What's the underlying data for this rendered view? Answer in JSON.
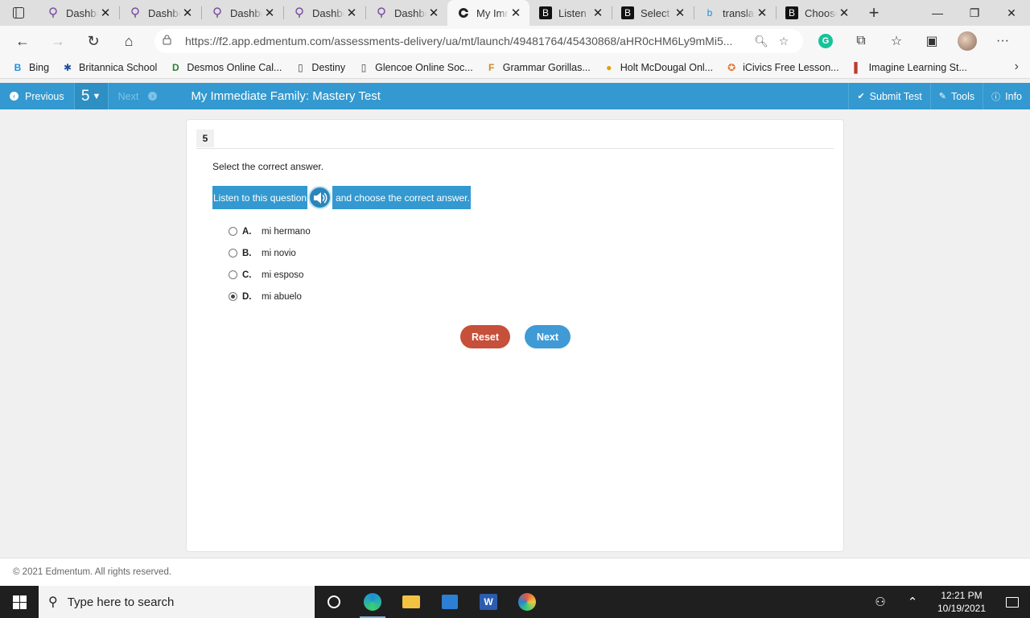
{
  "browser": {
    "tabs": [
      {
        "title": "Dashboard",
        "icon": "lightbulb-icon"
      },
      {
        "title": "Dashboard",
        "icon": "lightbulb-icon"
      },
      {
        "title": "Dashboard",
        "icon": "lightbulb-icon"
      },
      {
        "title": "Dashboard",
        "icon": "lightbulb-icon"
      },
      {
        "title": "Dashboard",
        "icon": "lightbulb-icon"
      },
      {
        "title": "My Immediate Family",
        "icon": "edmentum-icon"
      },
      {
        "title": "Listen to",
        "icon": "brainly-icon"
      },
      {
        "title": "Select",
        "icon": "brainly-icon"
      },
      {
        "title": "translate",
        "icon": "bing-icon"
      },
      {
        "title": "Choose",
        "icon": "brainly-icon"
      }
    ],
    "url": "https://f2.app.edmentum.com/assessments-delivery/ua/mt/launch/49481764/45430868/aHR0cHM6Ly9mMi5...",
    "bookmarks": [
      {
        "label": "Bing",
        "icon": "B",
        "color": "#1a8fde"
      },
      {
        "label": "Britannica School",
        "icon": "✱",
        "color": "#1f4ea3"
      },
      {
        "label": "Desmos Online Cal...",
        "icon": "D",
        "color": "#2f7d32"
      },
      {
        "label": "Destiny",
        "icon": "▯",
        "color": "#444444"
      },
      {
        "label": "Glencoe Online Soc...",
        "icon": "▯",
        "color": "#444444"
      },
      {
        "label": "Grammar Gorillas...",
        "icon": "F",
        "color": "#d48a1e"
      },
      {
        "label": "Holt McDougal Onl...",
        "icon": "●",
        "color": "#e6a100"
      },
      {
        "label": "iCivics  Free Lesson...",
        "icon": "✪",
        "color": "#e8712e"
      },
      {
        "label": "Imagine Learning St...",
        "icon": "▌",
        "color": "#c0392b"
      }
    ]
  },
  "app": {
    "prev_label": "Previous",
    "question_number": "5",
    "next_label": "Next",
    "title": "My Immediate Family: Mastery Test",
    "submit_label": "Submit Test",
    "tools_label": "Tools",
    "info_label": "Info"
  },
  "question": {
    "number": "5",
    "instruction": "Select the correct answer.",
    "prompt_before": "Listen to this question",
    "prompt_after": "and choose the correct answer.",
    "choices": [
      {
        "letter": "A.",
        "text": "mi hermano",
        "selected": false
      },
      {
        "letter": "B.",
        "text": "mi novio",
        "selected": false
      },
      {
        "letter": "C.",
        "text": "mi esposo",
        "selected": false
      },
      {
        "letter": "D.",
        "text": "mi abuelo",
        "selected": true
      }
    ],
    "reset_label": "Reset",
    "next_label": "Next"
  },
  "footer": {
    "copyright": "© 2021 Edmentum. All rights reserved."
  },
  "taskbar": {
    "search_placeholder": "Type here to search",
    "time": "12:21 PM",
    "date": "10/19/2021"
  },
  "colors": {
    "accent": "#3399d0",
    "reset": "#c6503a",
    "next": "#3f9ad6"
  }
}
